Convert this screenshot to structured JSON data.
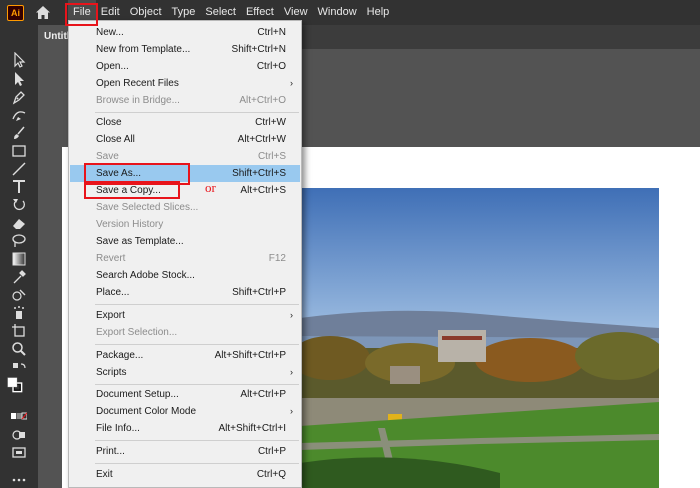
{
  "app": {
    "logo_text": "Ai",
    "doc_tab_title": "Untitled-1"
  },
  "menubar": {
    "items": [
      "File",
      "Edit",
      "Object",
      "Type",
      "Select",
      "Effect",
      "View",
      "Window",
      "Help"
    ],
    "active": "File"
  },
  "file_menu": {
    "items": [
      {
        "label": "New...",
        "shortcut": "Ctrl+N",
        "disabled": false
      },
      {
        "label": "New from Template...",
        "shortcut": "Shift+Ctrl+N",
        "disabled": false
      },
      {
        "label": "Open...",
        "shortcut": "Ctrl+O",
        "disabled": false
      },
      {
        "label": "Open Recent Files",
        "shortcut": "",
        "submenu": true,
        "disabled": false
      },
      {
        "label": "Browse in Bridge...",
        "shortcut": "Alt+Ctrl+O",
        "disabled": true
      },
      {
        "label": "Close",
        "shortcut": "Ctrl+W",
        "disabled": false
      },
      {
        "label": "Close All",
        "shortcut": "Alt+Ctrl+W",
        "disabled": false
      },
      {
        "label": "Save",
        "shortcut": "Ctrl+S",
        "disabled": true
      },
      {
        "label": "Save As...",
        "shortcut": "Shift+Ctrl+S",
        "disabled": false,
        "selected": true
      },
      {
        "label": "Save a Copy...",
        "shortcut": "Alt+Ctrl+S",
        "disabled": false
      },
      {
        "label": "Save Selected Slices...",
        "shortcut": "",
        "disabled": true
      },
      {
        "label": "Version History",
        "shortcut": "",
        "disabled": true
      },
      {
        "label": "Save as Template...",
        "shortcut": "",
        "disabled": false
      },
      {
        "label": "Revert",
        "shortcut": "F12",
        "disabled": true
      },
      {
        "label": "Search Adobe Stock...",
        "shortcut": "",
        "disabled": false
      },
      {
        "label": "Place...",
        "shortcut": "Shift+Ctrl+P",
        "disabled": false
      },
      {
        "label": "Export",
        "shortcut": "",
        "submenu": true,
        "disabled": false
      },
      {
        "label": "Export Selection...",
        "shortcut": "",
        "disabled": true
      },
      {
        "label": "Package...",
        "shortcut": "Alt+Shift+Ctrl+P",
        "disabled": false
      },
      {
        "label": "Scripts",
        "shortcut": "",
        "submenu": true,
        "disabled": false
      },
      {
        "label": "Document Setup...",
        "shortcut": "Alt+Ctrl+P",
        "disabled": false
      },
      {
        "label": "Document Color Mode",
        "shortcut": "",
        "submenu": true,
        "disabled": false
      },
      {
        "label": "File Info...",
        "shortcut": "Alt+Shift+Ctrl+I",
        "disabled": false
      },
      {
        "label": "Print...",
        "shortcut": "Ctrl+P",
        "disabled": false
      },
      {
        "label": "Exit",
        "shortcut": "Ctrl+Q",
        "disabled": false
      }
    ]
  },
  "annotation": {
    "or_text": "or",
    "highlight_color": "#e8141b"
  },
  "colors": {
    "menu_selected": "#99c9ef",
    "menubar_bg": "#323232",
    "workspace_bg": "#535353",
    "logo_orange": "#ff9a00"
  },
  "toolbar_icons": [
    "selection-tool-icon",
    "direct-selection-tool-icon",
    "pen-tool-icon",
    "curvature-tool-icon",
    "paintbrush-tool-icon",
    "rectangle-tool-icon",
    "line-segment-tool-icon",
    "type-tool-icon",
    "rotate-tool-icon",
    "eraser-tool-icon",
    "lasso-tool-icon",
    "gradient-tool-icon",
    "eyedropper-tool-icon",
    "shape-builder-tool-icon",
    "symbol-sprayer-tool-icon",
    "artboard-tool-icon",
    "zoom-tool-icon"
  ]
}
